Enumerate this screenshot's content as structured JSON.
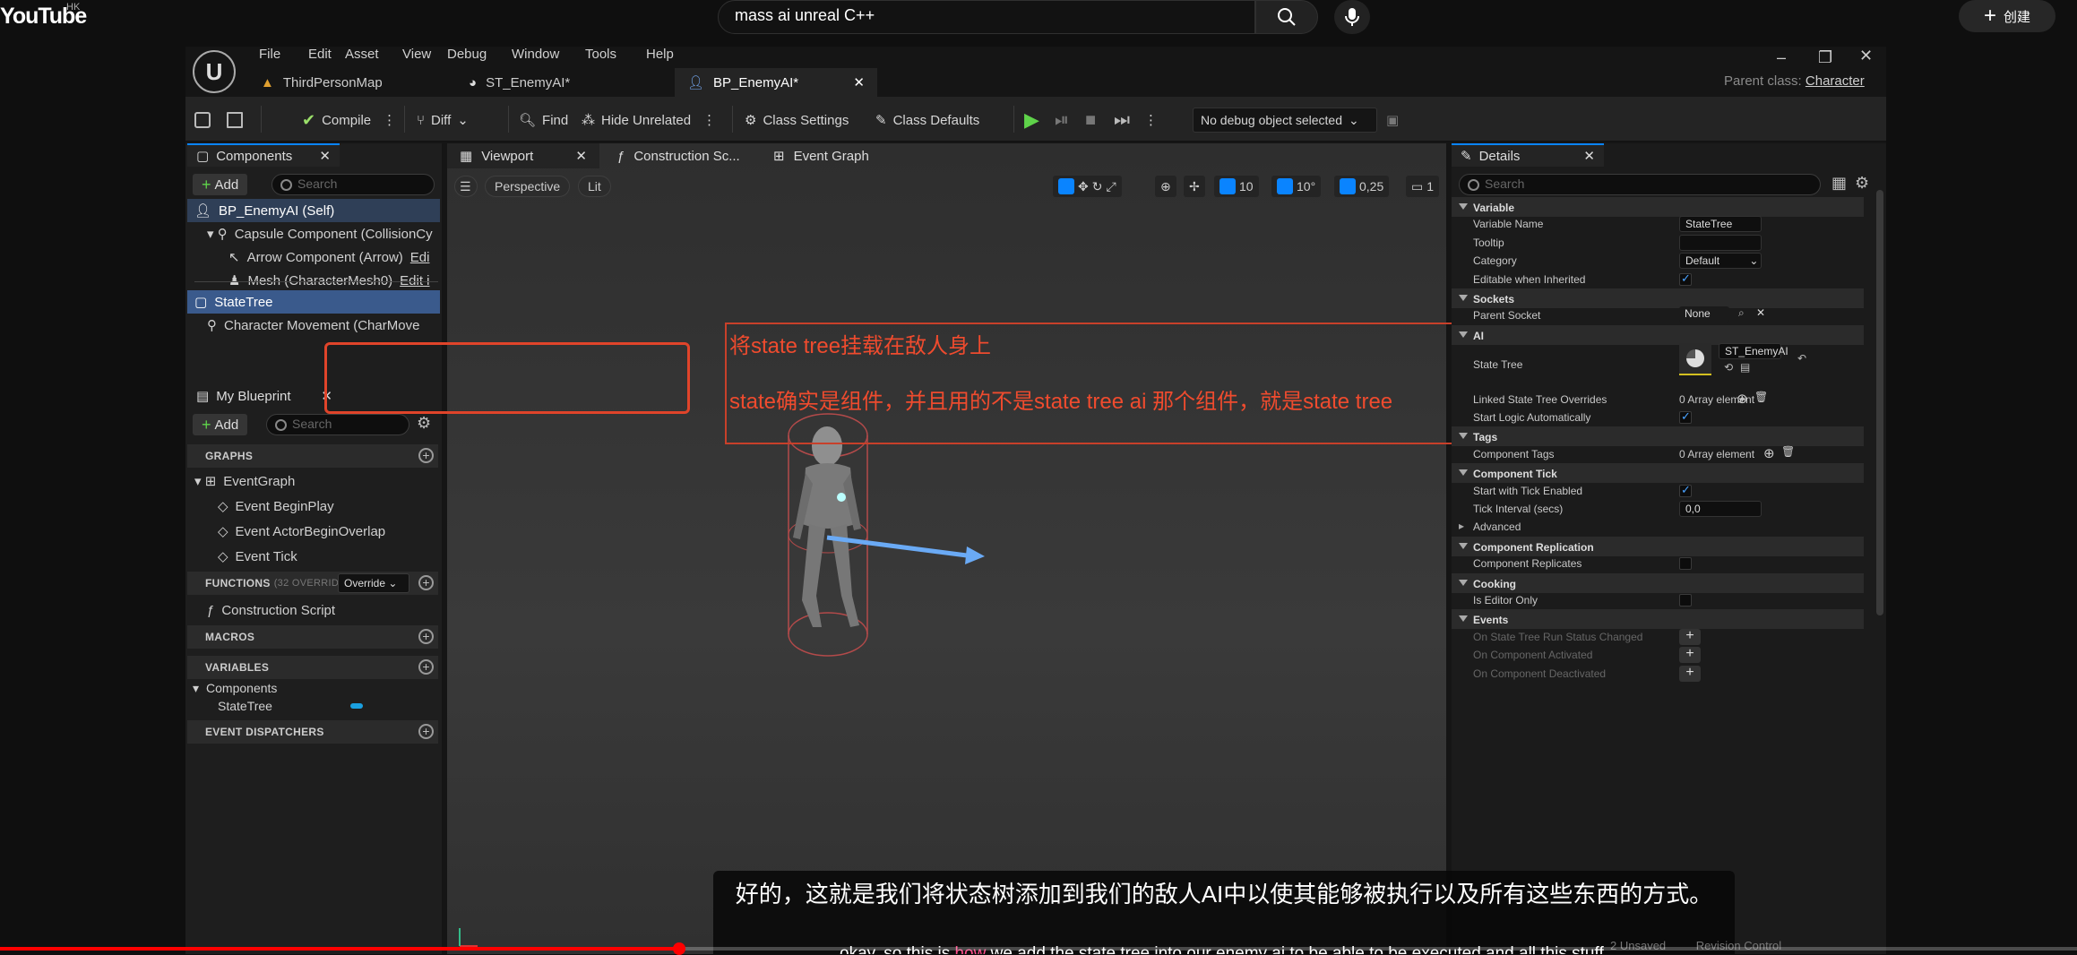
{
  "youtube": {
    "logo": "YouTube",
    "region": "HK",
    "search_value": "mass ai unreal C++",
    "create_label": "创建"
  },
  "editor": {
    "menus": [
      "File",
      "Edit",
      "Asset",
      "View",
      "Debug",
      "Window",
      "Tools",
      "Help"
    ],
    "tabs": [
      {
        "label": "ThirdPersonMap",
        "active": false
      },
      {
        "label": "ST_EnemyAI*",
        "active": false
      },
      {
        "label": "BP_EnemyAI*",
        "active": true
      }
    ],
    "parent_class_label": "Parent class:",
    "parent_class_value": "Character",
    "toolbar": {
      "compile": "Compile",
      "diff": "Diff",
      "find": "Find",
      "hide_unrelated": "Hide Unrelated",
      "class_settings": "Class Settings",
      "class_defaults": "Class Defaults",
      "debug_object": "No debug object selected"
    }
  },
  "components": {
    "tab": "Components",
    "add": "Add",
    "search_placeholder": "Search",
    "items": [
      {
        "label": "BP_EnemyAI (Self)"
      },
      {
        "label": "Capsule Component (CollisionCy"
      },
      {
        "label": "Arrow Component (Arrow)",
        "extra": "Edi"
      },
      {
        "label": "Mesh (CharacterMesh0)",
        "extra": "Edit i"
      },
      {
        "label": "StateTree"
      },
      {
        "label": "Character Movement (CharMove"
      }
    ]
  },
  "my_blueprint": {
    "tab": "My Blueprint",
    "add": "Add",
    "search_placeholder": "Search",
    "graphs_header": "GRAPHS",
    "event_graph": "EventGraph",
    "events": [
      "Event BeginPlay",
      "Event ActorBeginOverlap",
      "Event Tick"
    ],
    "functions_header": "FUNCTIONS",
    "functions_count": "(32 OVERRIDA",
    "override": "Override",
    "construction_script": "Construction Script",
    "macros_header": "MACROS",
    "variables_header": "VARIABLES",
    "components_group": "Components",
    "statetree_var": "StateTree",
    "dispatchers_header": "EVENT DISPATCHERS"
  },
  "viewport": {
    "tabs": [
      "Viewport",
      "Construction Sc...",
      "Event Graph"
    ],
    "perspective": "Perspective",
    "lit": "Lit",
    "grid": "10",
    "angle": "10°",
    "scale": "0,25",
    "camera": "1"
  },
  "annotation": {
    "line1": "将state tree挂载在敌人身上",
    "line2": "state确实是组件，并且用的不是state tree ai 那个组件，就是state tree"
  },
  "details": {
    "tab": "Details",
    "search_placeholder": "Search",
    "rows": [
      {
        "type": "section",
        "label": "Variable"
      },
      {
        "type": "field",
        "label": "Variable Name",
        "value": "StateTree"
      },
      {
        "type": "field",
        "label": "Tooltip",
        "value": ""
      },
      {
        "type": "dropdown",
        "label": "Category",
        "value": "Default"
      },
      {
        "type": "check",
        "label": "Editable when Inherited",
        "value": "on"
      },
      {
        "type": "section",
        "label": "Sockets"
      },
      {
        "type": "socket",
        "label": "Parent Socket",
        "value": "None"
      },
      {
        "type": "section",
        "label": "AI"
      },
      {
        "type": "statetree",
        "label": "State Tree",
        "value": "ST_EnemyAI"
      },
      {
        "type": "array",
        "label": "Linked State Tree Overrides",
        "value": "0 Array element"
      },
      {
        "type": "check",
        "label": "Start Logic Automatically",
        "value": "on"
      },
      {
        "type": "section",
        "label": "Tags"
      },
      {
        "type": "array",
        "label": "Component Tags",
        "value": "0 Array element"
      },
      {
        "type": "section",
        "label": "Component Tick"
      },
      {
        "type": "check",
        "label": "Start with Tick Enabled",
        "value": "on"
      },
      {
        "type": "field",
        "label": "Tick Interval (secs)",
        "value": "0,0"
      },
      {
        "type": "collapsed",
        "label": "Advanced"
      },
      {
        "type": "section",
        "label": "Component Replication"
      },
      {
        "type": "check",
        "label": "Component Replicates",
        "value": "off"
      },
      {
        "type": "section",
        "label": "Cooking"
      },
      {
        "type": "check",
        "label": "Is Editor Only",
        "value": "off"
      },
      {
        "type": "section",
        "label": "Events"
      },
      {
        "type": "event",
        "label": "On State Tree Run Status Changed"
      },
      {
        "type": "event",
        "label": "On Component Activated"
      },
      {
        "type": "event",
        "label": "On Component Deactivated"
      }
    ]
  },
  "caption": {
    "zh": "好的，这就是我们将状态树添加到我们的敌人AI中以使其能够被执行以及所有这些东西的方式。",
    "en_before": "okay, so this is",
    "en_highlight": "how",
    "en_after": "we add the state tree into our enemy ai to be able to be executed and all this stuff."
  },
  "player": {
    "progress": 0.327,
    "status_unsaved": "2 Unsaved",
    "revision_control": "Revision Control"
  }
}
